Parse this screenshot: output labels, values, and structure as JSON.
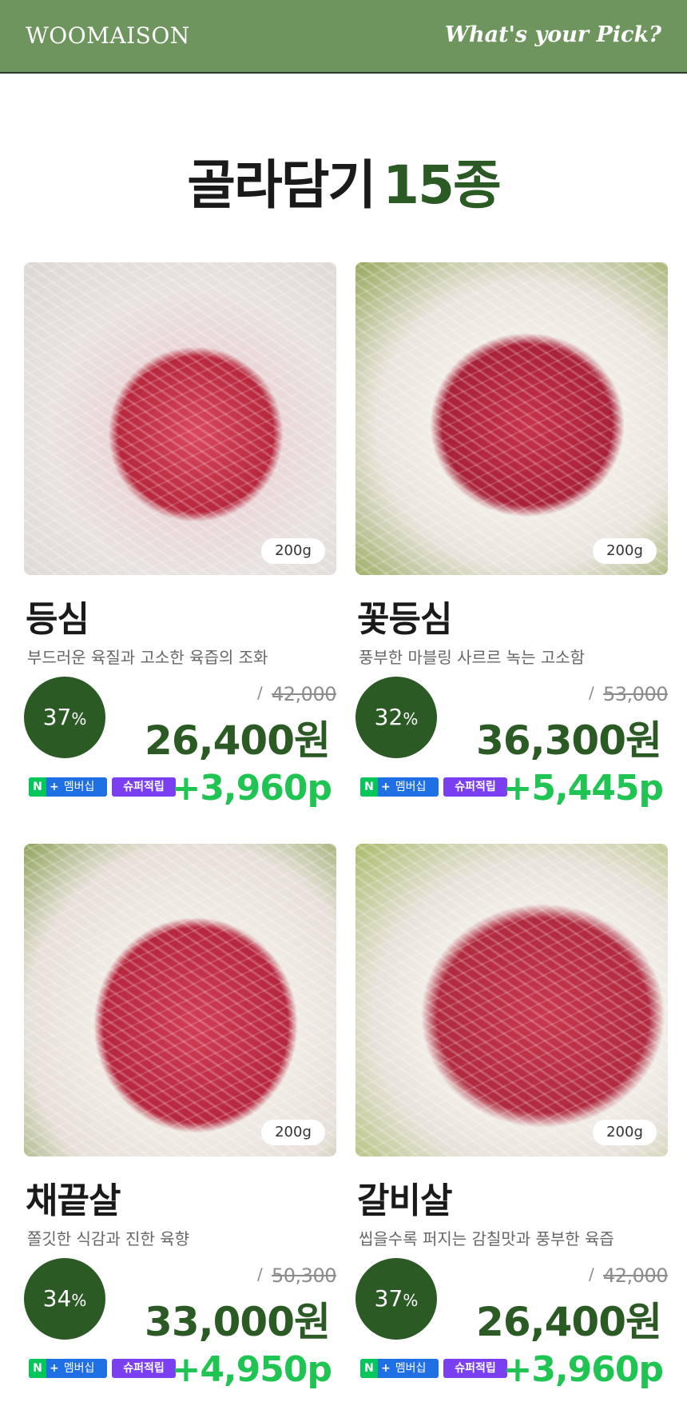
{
  "header": {
    "brand": "WOOMAISON",
    "tagline": "What's your Pick?"
  },
  "title": {
    "text": "골라담기",
    "count": "15종"
  },
  "products": [
    {
      "weight": "200g",
      "name": "등심",
      "description": "부드러운 육질과 고소한 육즙의 조화",
      "discount": "37",
      "discount_unit": "%",
      "original_price": "42,000",
      "sale_price": "26,400원",
      "membership_label": "멤버십",
      "n_label": "N",
      "plus_label": "+",
      "super_label": "슈퍼적립",
      "points": "+3,960p"
    },
    {
      "weight": "200g",
      "name": "꽃등심",
      "description": "풍부한 마블링 사르르 녹는 고소함",
      "discount": "32",
      "discount_unit": "%",
      "original_price": "53,000",
      "sale_price": "36,300원",
      "membership_label": "멤버십",
      "n_label": "N",
      "plus_label": "+",
      "super_label": "슈퍼적립",
      "points": "+5,445p"
    },
    {
      "weight": "200g",
      "name": "채끝살",
      "description": "쫄깃한 식감과 진한 육향",
      "discount": "34",
      "discount_unit": "%",
      "original_price": "50,300",
      "sale_price": "33,000원",
      "membership_label": "멤버십",
      "n_label": "N",
      "plus_label": "+",
      "super_label": "슈퍼적립",
      "points": "+4,950p"
    },
    {
      "weight": "200g",
      "name": "갈비살",
      "description": "씹을수록 퍼지는 감칠맛과 풍부한 육즙",
      "discount": "37",
      "discount_unit": "%",
      "original_price": "42,000",
      "sale_price": "26,400원",
      "membership_label": "멤버십",
      "n_label": "N",
      "plus_label": "+",
      "super_label": "슈퍼적립",
      "points": "+3,960p"
    }
  ],
  "colors": {
    "header_bg": "#6f955e",
    "accent_green": "#2b5a25",
    "points_green": "#1fc452",
    "naver_blue": "#1f6fe5",
    "naver_green": "#03c75a",
    "super_purple": "#7b3ff2"
  }
}
